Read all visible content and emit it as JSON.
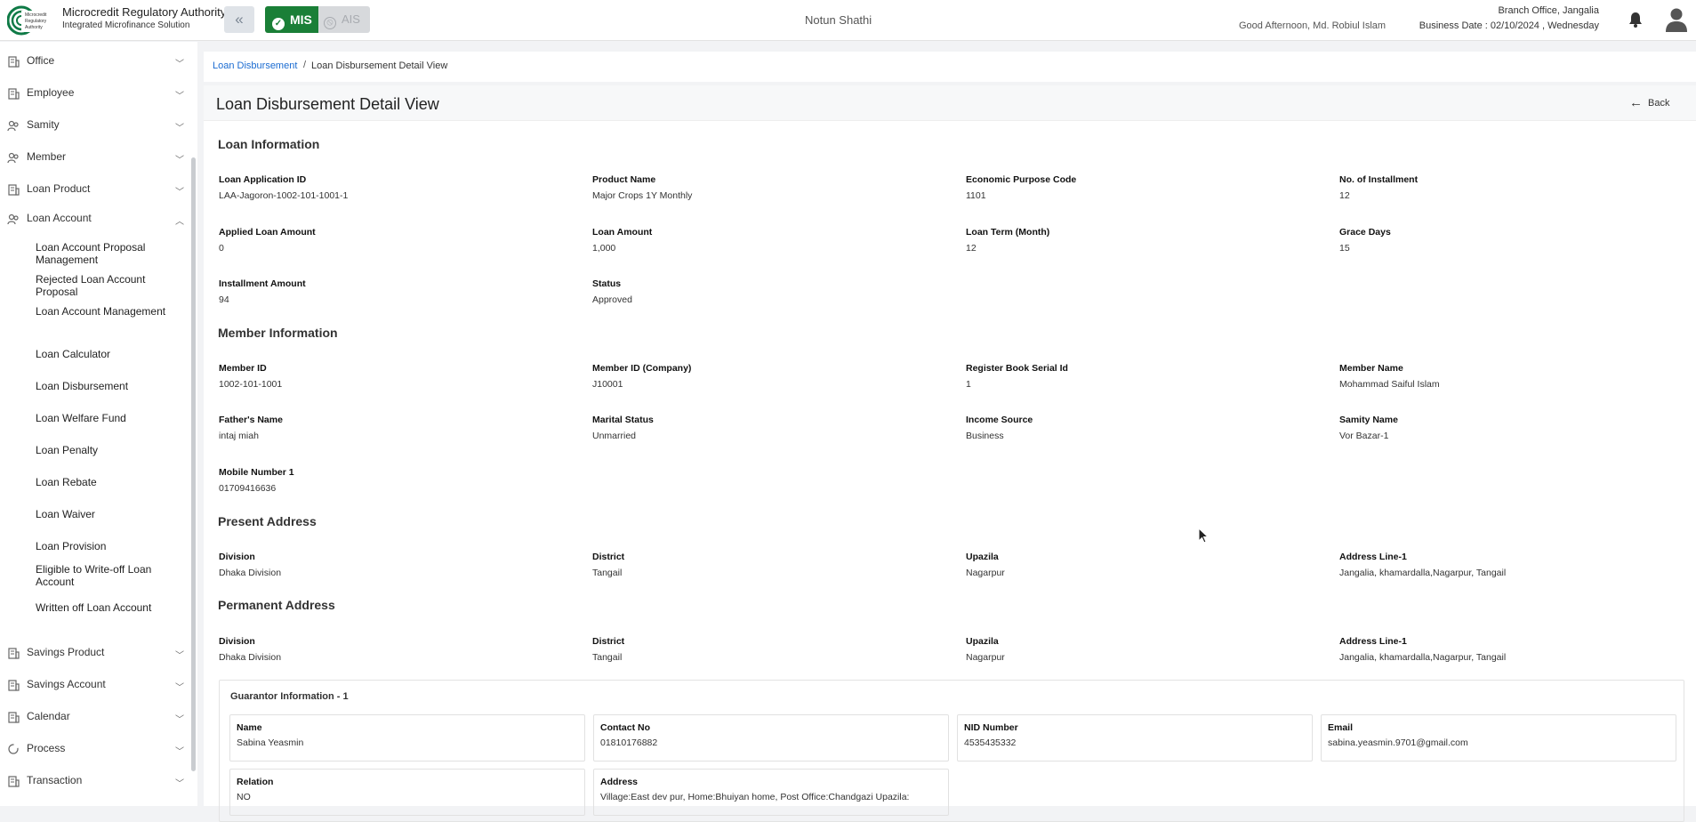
{
  "header": {
    "logo_text": "Microcredit Regulatory Authority",
    "org_title": "Microcredit Regulatory Authority",
    "org_subtitle": "Integrated Microfinance Solution",
    "mis_label": "MIS",
    "ais_label": "AIS",
    "org_name": "Notun Shathi",
    "greeting": "Good Afternoon, Md. Robiul Islam",
    "branch": "Branch Office, Jangalia",
    "business_date": "Business Date : 02/10/2024 , Wednesday",
    "colors": {
      "mis": "#1a7f37",
      "link": "#1a6bd1"
    }
  },
  "sidebar": {
    "items": [
      {
        "label": "Office",
        "icon": "building-icon"
      },
      {
        "label": "Employee",
        "icon": "building-icon"
      },
      {
        "label": "Samity",
        "icon": "group-icon"
      },
      {
        "label": "Member",
        "icon": "group-icon"
      },
      {
        "label": "Loan Product",
        "icon": "building-icon"
      },
      {
        "label": "Loan Account",
        "icon": "group-icon"
      }
    ],
    "loan_account_sub": [
      "Loan Account Proposal Management",
      "Rejected Loan Account Proposal",
      "Loan Account Management",
      "Loan Calculator",
      "Loan Disbursement",
      "Loan Welfare Fund",
      "Loan Penalty",
      "Loan Rebate",
      "Loan Waiver",
      "Loan Provision",
      "Eligible to Write-off Loan Account",
      "Written off Loan Account"
    ],
    "items_after": [
      {
        "label": "Savings Product",
        "icon": "building-icon"
      },
      {
        "label": "Savings Account",
        "icon": "building-icon"
      },
      {
        "label": "Calendar",
        "icon": "building-icon"
      },
      {
        "label": "Process",
        "icon": "refresh-icon"
      },
      {
        "label": "Transaction",
        "icon": "building-icon"
      }
    ]
  },
  "breadcrumb": {
    "link": "Loan Disbursement",
    "separator": "/",
    "current": "Loan Disbursement Detail View"
  },
  "page": {
    "title": "Loan Disbursement Detail View",
    "back_label": "Back"
  },
  "loan_info": {
    "title": "Loan Information",
    "fields": [
      {
        "label": "Loan Application ID",
        "value": "LAA-Jagoron-1002-101-1001-1"
      },
      {
        "label": "Product Name",
        "value": "Major Crops 1Y Monthly"
      },
      {
        "label": "Economic Purpose Code",
        "value": "1101"
      },
      {
        "label": "No. of Installment",
        "value": "12"
      },
      {
        "label": "Applied Loan Amount",
        "value": "0"
      },
      {
        "label": "Loan Amount",
        "value": "1,000"
      },
      {
        "label": "Loan Term (Month)",
        "value": "12"
      },
      {
        "label": "Grace Days",
        "value": "15"
      },
      {
        "label": "Installment Amount",
        "value": "94"
      },
      {
        "label": "Status",
        "value": "Approved"
      }
    ]
  },
  "member_info": {
    "title": "Member Information",
    "fields": [
      {
        "label": "Member ID",
        "value": "1002-101-1001"
      },
      {
        "label": "Member ID (Company)",
        "value": "J10001"
      },
      {
        "label": "Register Book Serial Id",
        "value": "1"
      },
      {
        "label": "Member Name",
        "value": "Mohammad Saiful Islam"
      },
      {
        "label": "Father's Name",
        "value": "intaj miah"
      },
      {
        "label": "Marital Status",
        "value": "Unmarried"
      },
      {
        "label": "Income Source",
        "value": "Business"
      },
      {
        "label": "Samity Name",
        "value": "Vor Bazar-1"
      },
      {
        "label": "Mobile Number 1",
        "value": "01709416636"
      }
    ]
  },
  "present_address": {
    "title": "Present Address",
    "fields": [
      {
        "label": "Division",
        "value": "Dhaka Division"
      },
      {
        "label": "District",
        "value": "Tangail"
      },
      {
        "label": "Upazila",
        "value": "Nagarpur"
      },
      {
        "label": "Address Line-1",
        "value": "Jangalia, khamardalla,Nagarpur, Tangail"
      }
    ]
  },
  "permanent_address": {
    "title": "Permanent Address",
    "fields": [
      {
        "label": "Division",
        "value": "Dhaka Division"
      },
      {
        "label": "District",
        "value": "Tangail"
      },
      {
        "label": "Upazila",
        "value": "Nagarpur"
      },
      {
        "label": "Address Line-1",
        "value": "Jangalia, khamardalla,Nagarpur, Tangail"
      }
    ]
  },
  "guarantor": {
    "title": "Guarantor Information - 1",
    "fields": [
      {
        "label": "Name",
        "value": "Sabina Yeasmin"
      },
      {
        "label": "Contact No",
        "value": "01810176882"
      },
      {
        "label": "NID Number",
        "value": "4535435332"
      },
      {
        "label": "Email",
        "value": "sabina.yeasmin.9701@gmail.com"
      },
      {
        "label": "Relation",
        "value": "NO"
      },
      {
        "label": "Address",
        "value": "Village:East dev pur, Home:Bhuiyan home, Post Office:Chandgazi Upazila:"
      }
    ]
  }
}
